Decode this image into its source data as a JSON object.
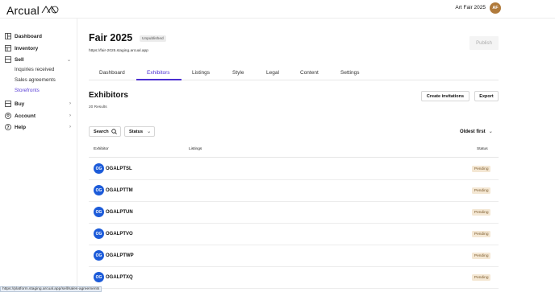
{
  "header": {
    "logo_text": "Arcual",
    "fair_name": "Art Fair 2025",
    "avatar_initials": "AF",
    "avatar_color": "#b07a3b"
  },
  "sidebar": {
    "items": [
      {
        "label": "Dashboard",
        "icon": "dashboard-icon"
      },
      {
        "label": "Inventory",
        "icon": "inventory-icon"
      },
      {
        "label": "Sell",
        "icon": "sell-icon",
        "expanded": true,
        "children": [
          {
            "label": "Inquiries received",
            "active": false
          },
          {
            "label": "Sales agreements",
            "active": false
          },
          {
            "label": "Storefronts",
            "active": true
          }
        ]
      },
      {
        "label": "Buy",
        "icon": "buy-icon"
      },
      {
        "label": "Account",
        "icon": "account-icon"
      },
      {
        "label": "Help",
        "icon": "help-icon"
      }
    ]
  },
  "page": {
    "title": "Fair 2025",
    "status_badge": "Unpublished",
    "url": "https://fair-2025.staging.arcual.app",
    "publish_label": "Publish"
  },
  "tabs": [
    {
      "label": "Dashboard",
      "active": false
    },
    {
      "label": "Exhibitors",
      "active": true
    },
    {
      "label": "Listings",
      "active": false
    },
    {
      "label": "Style",
      "active": false
    },
    {
      "label": "Legal",
      "active": false
    },
    {
      "label": "Content",
      "active": false
    },
    {
      "label": "Settings",
      "active": false
    }
  ],
  "exhibitors": {
    "title": "Exhibitors",
    "count": "20 Results",
    "create_invitations_label": "Create invitations",
    "export_label": "Export",
    "search_label": "Search",
    "status_filter_label": "Status",
    "sort_label": "Oldest first",
    "columns": [
      "Exhibitor",
      "Listings",
      "Status"
    ],
    "rows": [
      {
        "initials": "OG",
        "name": "OGALPTSL",
        "status": "Pending"
      },
      {
        "initials": "OG",
        "name": "OGALPTTM",
        "status": "Pending"
      },
      {
        "initials": "OG",
        "name": "OGALPTUN",
        "status": "Pending"
      },
      {
        "initials": "OG",
        "name": "OGALPTVO",
        "status": "Pending"
      },
      {
        "initials": "OG",
        "name": "OGALPTWP",
        "status": "Pending"
      },
      {
        "initials": "OG",
        "name": "OGALPTXQ",
        "status": "Pending"
      }
    ]
  },
  "statusbar": {
    "url": "https://platform.staging.arcual.app/sell/sales-agreements"
  },
  "colors": {
    "accent": "#4b2fd1",
    "row_avatar": "#1c5bd9",
    "pending_bg": "#f4e7d3",
    "pending_text": "#7a5a2c"
  }
}
